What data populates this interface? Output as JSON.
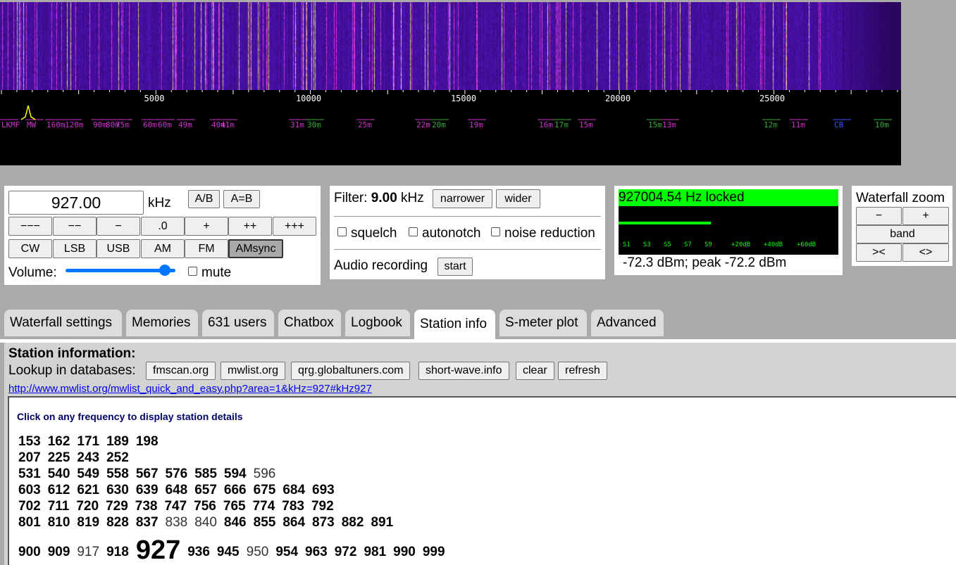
{
  "waterfall": {
    "colors": {
      "background": "#0a0620",
      "mid": "#5a10c0",
      "bright": "#ff40ff",
      "hot": "#fff3b0"
    },
    "scale_labels": [
      "5000",
      "10000",
      "15000",
      "20000",
      "25000"
    ],
    "band_labels": [
      {
        "text": "LKMF",
        "color": "#cc33cc"
      },
      {
        "text": "MW",
        "color": "#cc33cc"
      },
      {
        "text": "160m",
        "color": "#cc33cc"
      },
      {
        "text": "120m",
        "color": "#cc33cc"
      },
      {
        "text": "90m",
        "color": "#cc33cc"
      },
      {
        "text": "80m",
        "color": "#cc33cc"
      },
      {
        "text": "75m",
        "color": "#cc33cc"
      },
      {
        "text": "60m",
        "color": "#cc33cc"
      },
      {
        "text": "60m",
        "color": "#cc33cc"
      },
      {
        "text": "49m",
        "color": "#cc33cc"
      },
      {
        "text": "40m",
        "color": "#cc33cc"
      },
      {
        "text": "41m",
        "color": "#cc33cc"
      },
      {
        "text": "31m",
        "color": "#cc33cc"
      },
      {
        "text": "30m",
        "color": "#33aa33"
      },
      {
        "text": "25m",
        "color": "#cc33cc"
      },
      {
        "text": "22m",
        "color": "#cc33cc"
      },
      {
        "text": "20m",
        "color": "#33aa33"
      },
      {
        "text": "19m",
        "color": "#cc33cc"
      },
      {
        "text": "16m",
        "color": "#cc33cc"
      },
      {
        "text": "17m",
        "color": "#33aa33"
      },
      {
        "text": "15m",
        "color": "#cc33cc"
      },
      {
        "text": "15m",
        "color": "#33aa33"
      },
      {
        "text": "13m",
        "color": "#cc33cc"
      },
      {
        "text": "12m",
        "color": "#33aa33"
      },
      {
        "text": "11m",
        "color": "#cc33cc"
      },
      {
        "text": "CB",
        "color": "#3355ff"
      },
      {
        "text": "10m",
        "color": "#33aa33"
      }
    ]
  },
  "tuning": {
    "frequency": "927.00",
    "unit": "kHz",
    "ab_label": "A/B",
    "a_eq_b_label": "A=B",
    "step_buttons": [
      "−−−",
      "−−",
      "−",
      ".0",
      "+",
      "++",
      "+++"
    ],
    "modes": [
      "CW",
      "LSB",
      "USB",
      "AM",
      "FM",
      "AMsync"
    ],
    "selected_mode": "AMsync",
    "volume_label": "Volume:",
    "volume_level": 0.95,
    "mute_label": "mute"
  },
  "filter": {
    "label": "Filter:",
    "value": "9.00",
    "unit": "kHz",
    "narrower_label": "narrower",
    "wider_label": "wider",
    "squelch_label": "squelch",
    "autonotch_label": "autonotch",
    "noise_reduction_label": "noise reduction",
    "recording_label": "Audio recording",
    "start_label": "start"
  },
  "smeter": {
    "lock_text_a": "927",
    "lock_text_b": "004.54 Hz locked",
    "level": 0.42,
    "scale": [
      "S1",
      "S3",
      "S5",
      "S7",
      "S9",
      "+20dB",
      "+40dB",
      "+60dB"
    ],
    "reading": "-72.3 dBm; peak  -72.2 dBm",
    "colors": {
      "accent": "#00ff00",
      "background": "#000000"
    }
  },
  "zoom": {
    "title": "Waterfall zoom",
    "minus_label": "−",
    "plus_label": "+",
    "band_label": "band",
    "narrow_label": "><",
    "wide_label": "<>"
  },
  "tabs": [
    {
      "label": "Waterfall settings"
    },
    {
      "label": "Memories"
    },
    {
      "label": "631 users"
    },
    {
      "label": "Chatbox"
    },
    {
      "label": "Logbook"
    },
    {
      "label": "Station info",
      "active": true
    },
    {
      "label": "S-meter plot"
    },
    {
      "label": "Advanced"
    }
  ],
  "station": {
    "title": "Station information:",
    "lookup_label": "Lookup in databases:",
    "lookup_buttons": [
      "fmscan.org",
      "mwlist.org",
      "qrg.globaltuners.com",
      "short-wave.info",
      "clear",
      "refresh"
    ],
    "url": "http://www.mwlist.org/mwlist_quick_and_easy.php?area=1&kHz=927#kHz927",
    "hint": "Click on any frequency to display station details",
    "rows": [
      [
        {
          "f": "153",
          "b": true
        },
        {
          "f": "162",
          "b": true
        },
        {
          "f": "171",
          "b": true
        },
        {
          "f": "189",
          "b": true
        },
        {
          "f": "198",
          "b": true
        }
      ],
      [
        {
          "f": "207",
          "b": true
        },
        {
          "f": "225",
          "b": true
        },
        {
          "f": "243",
          "b": true
        },
        {
          "f": "252",
          "b": true
        }
      ],
      [
        {
          "f": "531",
          "b": true
        },
        {
          "f": "540",
          "b": true
        },
        {
          "f": "549",
          "b": true
        },
        {
          "f": "558",
          "b": true
        },
        {
          "f": "567",
          "b": true
        },
        {
          "f": "576",
          "b": true
        },
        {
          "f": "585",
          "b": true
        },
        {
          "f": "594",
          "b": true
        },
        {
          "f": "596",
          "b": false
        }
      ],
      [
        {
          "f": "603",
          "b": true
        },
        {
          "f": "612",
          "b": true
        },
        {
          "f": "621",
          "b": true
        },
        {
          "f": "630",
          "b": true
        },
        {
          "f": "639",
          "b": true
        },
        {
          "f": "648",
          "b": true
        },
        {
          "f": "657",
          "b": true
        },
        {
          "f": "666",
          "b": true
        },
        {
          "f": "675",
          "b": true
        },
        {
          "f": "684",
          "b": true
        },
        {
          "f": "693",
          "b": true
        }
      ],
      [
        {
          "f": "702",
          "b": true
        },
        {
          "f": "711",
          "b": true
        },
        {
          "f": "720",
          "b": true
        },
        {
          "f": "729",
          "b": true
        },
        {
          "f": "738",
          "b": true
        },
        {
          "f": "747",
          "b": true
        },
        {
          "f": "756",
          "b": true
        },
        {
          "f": "765",
          "b": true
        },
        {
          "f": "774",
          "b": true
        },
        {
          "f": "783",
          "b": true
        },
        {
          "f": "792",
          "b": true
        }
      ],
      [
        {
          "f": "801",
          "b": true
        },
        {
          "f": "810",
          "b": true
        },
        {
          "f": "819",
          "b": true
        },
        {
          "f": "828",
          "b": true
        },
        {
          "f": "837",
          "b": true
        },
        {
          "f": "838",
          "b": false
        },
        {
          "f": "840",
          "b": false
        },
        {
          "f": "846",
          "b": true
        },
        {
          "f": "855",
          "b": true
        },
        {
          "f": "864",
          "b": true
        },
        {
          "f": "873",
          "b": true
        },
        {
          "f": "882",
          "b": true
        },
        {
          "f": "891",
          "b": true
        }
      ],
      [
        {
          "f": "900",
          "b": true
        },
        {
          "f": "909",
          "b": true
        },
        {
          "f": "917",
          "b": false
        },
        {
          "f": "918",
          "b": true
        },
        {
          "f": "927",
          "b": true,
          "current": true
        },
        {
          "f": "936",
          "b": true
        },
        {
          "f": "945",
          "b": true
        },
        {
          "f": "950",
          "b": false
        },
        {
          "f": "954",
          "b": true
        },
        {
          "f": "963",
          "b": true
        },
        {
          "f": "972",
          "b": true
        },
        {
          "f": "981",
          "b": true
        },
        {
          "f": "990",
          "b": true
        },
        {
          "f": "999",
          "b": true
        }
      ]
    ]
  }
}
